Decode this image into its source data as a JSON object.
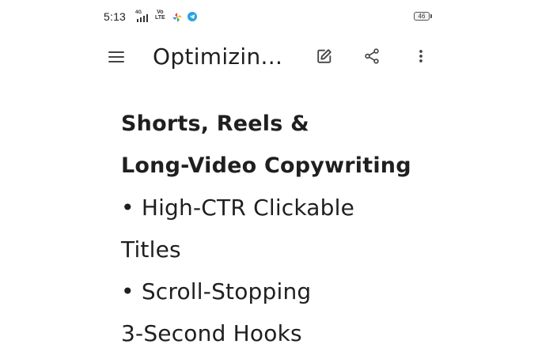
{
  "status_bar": {
    "time": "5:13",
    "signal_label": "4G",
    "volte_top": "Vo",
    "volte_bottom": "LTE",
    "battery_level": "46"
  },
  "app_bar": {
    "title": "Optimizin...",
    "icons": {
      "menu": "menu-icon",
      "edit": "edit-icon",
      "share": "share-icon",
      "more": "more-vert-icon"
    }
  },
  "document": {
    "heading_lines": [
      "Shorts, Reels &",
      "Long-Video Copywriting"
    ],
    "bullets": [
      {
        "lines": [
          "• High-CTR Clickable",
          "Titles"
        ]
      },
      {
        "lines": [
          "• Scroll-Stopping",
          "3-Second Hooks"
        ]
      }
    ]
  },
  "colors": {
    "text": "#1f1f1f",
    "background": "#ffffff",
    "pinwheel": [
      "#ea4335",
      "#fbbc05",
      "#34a853",
      "#4285f4"
    ],
    "telegram": "#2aa3df"
  }
}
